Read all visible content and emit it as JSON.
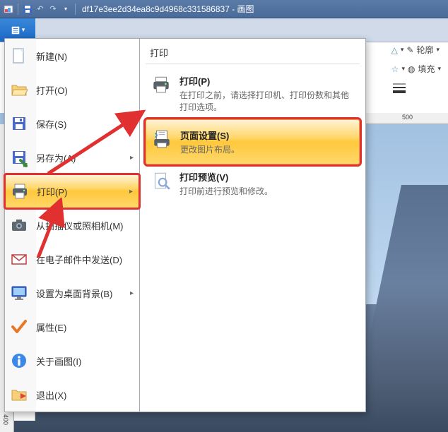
{
  "titlebar": {
    "filename": "df17e3ee2d34ea8c9d4968c331586837",
    "appname": "画图"
  },
  "ribbon_right": {
    "outline_label": "轮廓",
    "fill_label": "填充"
  },
  "ruler": {
    "mark500": "500",
    "mark400": "400"
  },
  "menu": {
    "items": [
      {
        "label": "新建(N)",
        "has_arrow": false
      },
      {
        "label": "打开(O)",
        "has_arrow": false
      },
      {
        "label": "保存(S)",
        "has_arrow": false
      },
      {
        "label": "另存为(A)",
        "has_arrow": true
      },
      {
        "label": "打印(P)",
        "has_arrow": true
      },
      {
        "label": "从扫描仪或照相机(M)",
        "has_arrow": false
      },
      {
        "label": "在电子邮件中发送(D)",
        "has_arrow": false
      },
      {
        "label": "设置为桌面背景(B)",
        "has_arrow": true
      },
      {
        "label": "属性(E)",
        "has_arrow": false
      },
      {
        "label": "关于画图(I)",
        "has_arrow": false
      },
      {
        "label": "退出(X)",
        "has_arrow": false
      }
    ]
  },
  "submenu": {
    "title": "打印",
    "items": [
      {
        "title": "打印(P)",
        "desc": "在打印之前，请选择打印机、打印份数和其他打印选项。"
      },
      {
        "title": "页面设置(S)",
        "desc": "更改图片布局。"
      },
      {
        "title": "打印预览(V)",
        "desc": "打印前进行预览和修改。"
      }
    ]
  }
}
